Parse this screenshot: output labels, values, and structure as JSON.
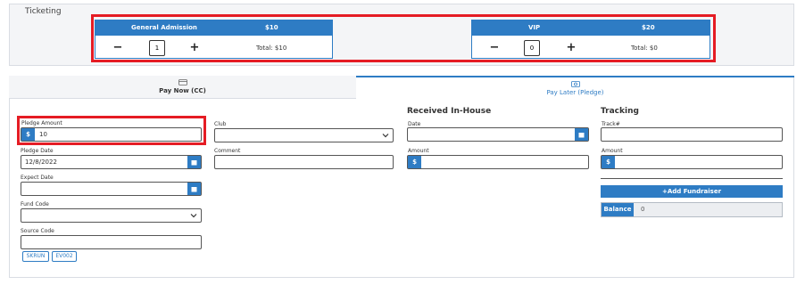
{
  "ticketing": {
    "title": "Ticketing",
    "tickets": [
      {
        "name": "General Admission",
        "price": "$10",
        "quantity": "1",
        "total": "Total: $10",
        "minus": "−",
        "plus": "+"
      },
      {
        "name": "VIP",
        "price": "$20",
        "quantity": "0",
        "total": "Total: $0",
        "minus": "−",
        "plus": "+"
      }
    ]
  },
  "tabs": {
    "pay_now": {
      "label": "Pay Now (CC)",
      "icon": "credit-card-icon",
      "active": false
    },
    "pay_later": {
      "label": "Pay Later (Pledge)",
      "icon": "money-icon",
      "active": true
    }
  },
  "pledge": {
    "amount_label": "Pledge Amount",
    "amount_prefix": "$",
    "amount_value": "10",
    "date_label": "Pledge Date",
    "date_value": "12/8/2022",
    "expect_label": "Expect Date",
    "expect_value": "",
    "fund_label": "Fund Code",
    "fund_value": "",
    "source_label": "Source Code",
    "source_value": "",
    "chips": [
      "SKRUN",
      "EV002"
    ]
  },
  "misc": {
    "club_label": "Club",
    "club_value": "",
    "comment_label": "Comment",
    "comment_value": ""
  },
  "received": {
    "heading": "Received In-House",
    "date_label": "Date",
    "date_value": "",
    "amount_label": "Amount",
    "amount_prefix": "$",
    "amount_value": ""
  },
  "tracking": {
    "heading": "Tracking",
    "track_label": "Track#",
    "track_value": "",
    "amount_label": "Amount",
    "amount_prefix": "$",
    "amount_value": "",
    "add_fundraiser": "+Add Fundraiser",
    "balance_label": "Balance",
    "balance_value": "0"
  },
  "colors": {
    "accent": "#2e7cc4",
    "highlight": "#e51c24",
    "panel": "#f4f5f7"
  }
}
